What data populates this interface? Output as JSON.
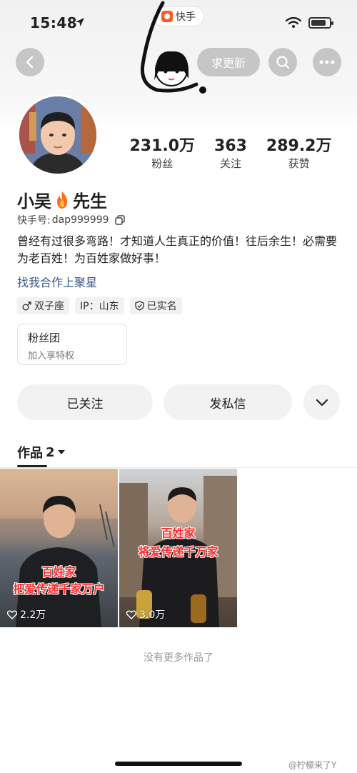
{
  "status_bar": {
    "time": "15:48",
    "app_name": "快手"
  },
  "header": {
    "update_label": "求更新",
    "icons": [
      "back-arrow-icon",
      "search-icon",
      "more-icon"
    ]
  },
  "profile": {
    "stats": [
      {
        "value": "231.0万",
        "label": "粉丝"
      },
      {
        "value": "363",
        "label": "关注"
      },
      {
        "value": "289.2万",
        "label": "获赞"
      }
    ],
    "name_part1": "小吴",
    "name_part2": "先生",
    "kuaishou_id_label": "快手号: ",
    "kuaishou_id": "dap999999",
    "bio": "曾经有过很多弯路！才知道人生真正的价值！往后余生！必需要为老百姓！为百姓家做好事！",
    "link": "找我合作上聚星",
    "tags": [
      "双子座",
      "IP：山东",
      "已实名"
    ]
  },
  "fan_club": {
    "title": "粉丝团",
    "subtitle": "加入享特权"
  },
  "actions": {
    "follow": "已关注",
    "message": "发私信"
  },
  "tabs": {
    "works_label": "作品",
    "works_count": "2"
  },
  "videos": [
    {
      "caption_line1": "百姓家",
      "caption_line2": "把爱传递千家万户",
      "likes": "2.2万"
    },
    {
      "caption_line1": "百姓家",
      "caption_line2": "将爱传递千万家",
      "likes": "3.0万"
    }
  ],
  "footer": {
    "no_more": "没有更多作品了",
    "watermark": "@柠檬来了Y"
  }
}
